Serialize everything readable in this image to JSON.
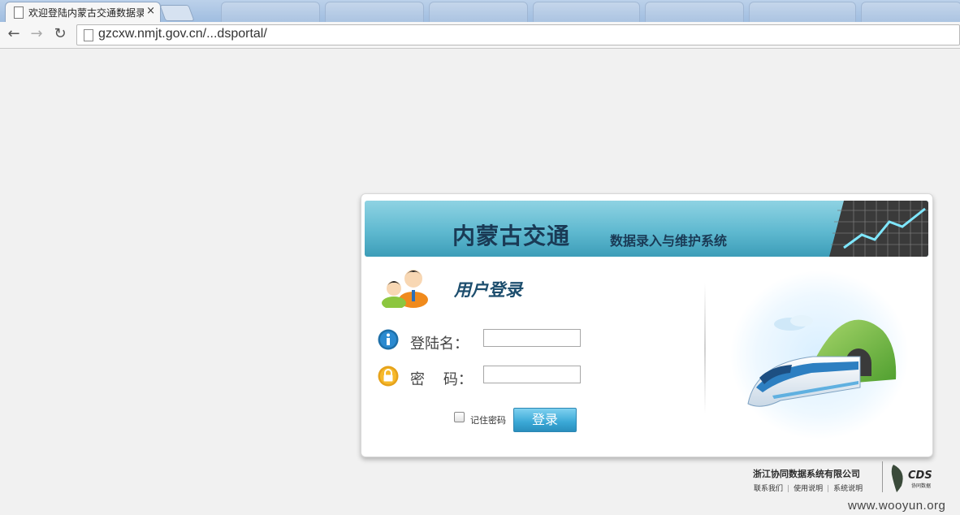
{
  "browser": {
    "active_tab_title": "欢迎登陆内蒙古交通数据录",
    "tab_close": "×",
    "url": "gzcxw.nmjt.gov.cn/...dsportal/"
  },
  "banner": {
    "title": "内蒙古交通",
    "subtitle": "数据录入与维护系统"
  },
  "login": {
    "heading": "用户登录",
    "username_label": "登陆名：",
    "username_value": "",
    "password_label": "密    码：",
    "password_value": "",
    "remember_label": "记住密码",
    "remember_checked": false,
    "submit_label": "登录"
  },
  "footer": {
    "company": "浙江协同数据系统有限公司",
    "links": [
      "联系我们",
      "使用说明",
      "系统说明"
    ],
    "logo_text": "CDS",
    "logo_subtext": "协同数据"
  },
  "watermark": "www.wooyun.org",
  "colors": {
    "banner_top": "#8fd3e3",
    "banner_bottom": "#3c9db8",
    "heading_text": "#1d4e6e",
    "button": "#3aa8d6",
    "page_bg": "#f1f1f1"
  },
  "icons": [
    "page-icon",
    "close-icon",
    "back-icon",
    "forward-icon",
    "reload-icon",
    "users-icon",
    "info-icon",
    "lock-icon",
    "train-icon",
    "leaf-logo-icon",
    "chart-icon"
  ]
}
